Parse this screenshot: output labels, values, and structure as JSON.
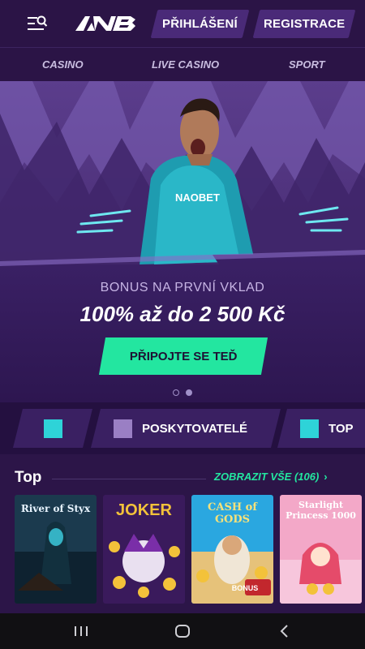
{
  "header": {
    "menu_icon": "search-menu-icon",
    "logo_text": "NB",
    "login_label": "PŘIHLÁŠENÍ",
    "register_label": "REGISTRACE"
  },
  "nav": {
    "items": [
      {
        "label": "CASINO"
      },
      {
        "label": "LIVE CASINO"
      },
      {
        "label": "SPORT"
      }
    ]
  },
  "banner": {
    "shirt_text": "NAOBET",
    "bonus_subtitle": "BONUS NA PRVNÍ VKLAD",
    "bonus_title": "100% až do 2 500 Kč",
    "cta_label": "PŘIPOJTE SE TEĎ",
    "slides": 2,
    "active_slide": 2
  },
  "categories": {
    "items": [
      {
        "label": "",
        "icon": "square-icon"
      },
      {
        "label": "POSKYTOVATELÉ",
        "icon": "square-icon"
      },
      {
        "label": "TOP",
        "icon": "square-icon"
      }
    ]
  },
  "top": {
    "title": "Top",
    "view_all_label": "ZOBRAZIT VŠE (106)",
    "games": [
      {
        "name": "River of Styx"
      },
      {
        "name": "JOKER"
      },
      {
        "name": "CASH of GODS",
        "badge": "BONUS"
      },
      {
        "name": "Starlight Princess 1000"
      }
    ]
  },
  "colors": {
    "background": "#2c1548",
    "accent": "#23e6a0",
    "button": "#4a2a78",
    "icon_cyan": "#2ed3d8",
    "icon_lilac": "#9a7fc4"
  },
  "system_nav": {
    "recent_icon": "recent-apps-icon",
    "home_icon": "home-icon",
    "back_icon": "back-icon"
  }
}
